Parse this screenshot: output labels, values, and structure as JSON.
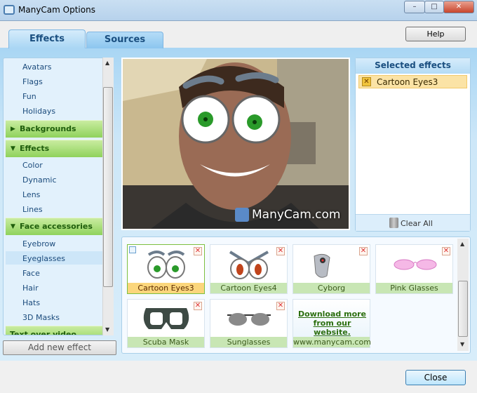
{
  "window": {
    "title": "ManyCam Options",
    "minimize": "–",
    "maximize": "□",
    "close": "✕"
  },
  "tabs": [
    {
      "label": "Effects",
      "active": true
    },
    {
      "label": "Sources",
      "active": false
    }
  ],
  "help_label": "Help",
  "sidebar": {
    "items_top": [
      "Avatars",
      "Flags",
      "Fun",
      "Holidays"
    ],
    "groups": [
      {
        "label": "Backgrounds",
        "expanded": false
      },
      {
        "label": "Effects",
        "expanded": true,
        "items": [
          "Color",
          "Dynamic",
          "Lens",
          "Lines"
        ]
      },
      {
        "label": "Face accessories",
        "expanded": true,
        "items": [
          "Eyebrow",
          "Eyeglasses",
          "Face",
          "Hair",
          "Hats",
          "3D Masks"
        ],
        "selected": "Eyeglasses"
      },
      {
        "label": "Text over video",
        "expanded": false
      }
    ]
  },
  "add_effect_label": "Add new effect",
  "video": {
    "watermark": "ManyCam.com"
  },
  "selected_effects": {
    "title": "Selected effects",
    "items": [
      "Cartoon Eyes3"
    ],
    "clear_all": "Clear All"
  },
  "gallery": {
    "tiles": [
      {
        "label": "Cartoon Eyes3",
        "selected": true
      },
      {
        "label": "Cartoon Eyes4",
        "selected": false
      },
      {
        "label": "Cyborg",
        "selected": false
      },
      {
        "label": "Pink Glasses",
        "selected": false
      },
      {
        "label": "Scuba Mask",
        "selected": false
      },
      {
        "label": "Sunglasses",
        "selected": false
      }
    ],
    "download": {
      "line1": "Download more",
      "line2": "from our website",
      "url": "www.manycam.com"
    }
  },
  "close_label": "Close",
  "colors": {
    "accent": "#1a4f80",
    "group_green": "#8fd25c",
    "selected": "#fbd67c"
  }
}
